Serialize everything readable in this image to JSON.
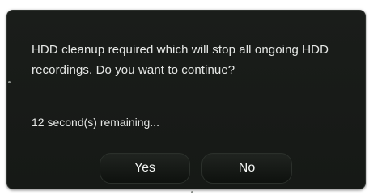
{
  "dialog": {
    "message": "HDD cleanup required which will stop all ongoing HDD recordings. Do you want to continue?",
    "countdown": "12 second(s) remaining...",
    "buttons": {
      "yes_label": "Yes",
      "no_label": "No"
    }
  },
  "colors": {
    "dialog_background": "#181b18",
    "text": "#e6e8e6",
    "button_background": "#151915"
  }
}
